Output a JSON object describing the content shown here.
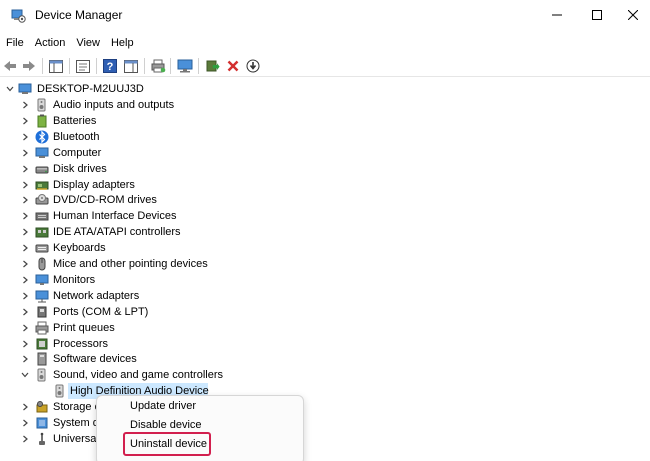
{
  "window": {
    "title": "Device Manager"
  },
  "menu": [
    "File",
    "Action",
    "View",
    "Help"
  ],
  "tree": {
    "root": "DESKTOP-M2UUJ3D",
    "categories": [
      {
        "label": "Audio inputs and outputs",
        "icon": "speaker-icon"
      },
      {
        "label": "Batteries",
        "icon": "battery-icon"
      },
      {
        "label": "Bluetooth",
        "icon": "bluetooth-icon"
      },
      {
        "label": "Computer",
        "icon": "computer-icon"
      },
      {
        "label": "Disk drives",
        "icon": "disk-drive-icon"
      },
      {
        "label": "Display adapters",
        "icon": "display-adapter-icon"
      },
      {
        "label": "DVD/CD-ROM drives",
        "icon": "dvd-drive-icon"
      },
      {
        "label": "Human Interface Devices",
        "icon": "hid-icon"
      },
      {
        "label": "IDE ATA/ATAPI controllers",
        "icon": "ide-controller-icon"
      },
      {
        "label": "Keyboards",
        "icon": "keyboard-icon"
      },
      {
        "label": "Mice and other pointing devices",
        "icon": "mouse-icon"
      },
      {
        "label": "Monitors",
        "icon": "monitor-icon"
      },
      {
        "label": "Network adapters",
        "icon": "network-adapter-icon"
      },
      {
        "label": "Ports (COM & LPT)",
        "icon": "port-icon"
      },
      {
        "label": "Print queues",
        "icon": "printer-icon"
      },
      {
        "label": "Processors",
        "icon": "processor-icon"
      },
      {
        "label": "Software devices",
        "icon": "software-device-icon"
      },
      {
        "label": "Sound, video and game controllers",
        "icon": "speaker-icon",
        "expanded": true
      },
      {
        "label": "Storage c",
        "icon": "storage-icon"
      },
      {
        "label": "System d",
        "icon": "system-device-icon"
      },
      {
        "label": "Universal",
        "icon": "usb-icon"
      }
    ],
    "child": "High Definition Audio Device"
  },
  "context_menu": {
    "items": [
      "Update driver",
      "Disable device",
      "Uninstall device"
    ],
    "highlighted": "Uninstall device",
    "highlight_color": "#d21f4e"
  },
  "colors": {
    "selection": "#cce8ff",
    "accent_blue": "#0078d4",
    "delete_red": "#d32f2f"
  }
}
